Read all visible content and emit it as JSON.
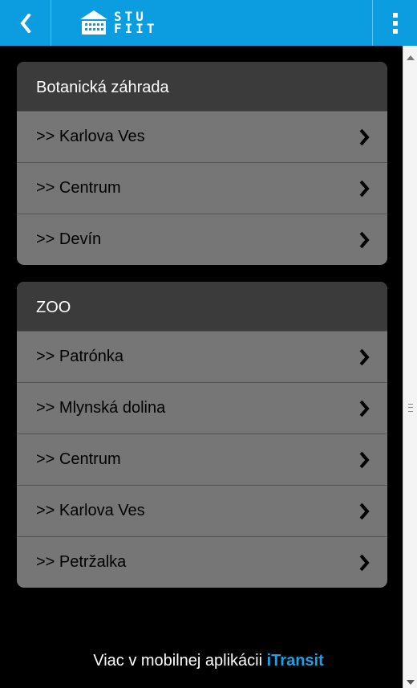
{
  "header": {
    "logo_line1": "STU",
    "logo_line2": "FIIT",
    "accent": "#0b9de0"
  },
  "groups": [
    {
      "title": "Botanická záhrada",
      "items": [
        ">> Karlova Ves",
        ">> Centrum",
        ">> Devín"
      ]
    },
    {
      "title": "ZOO",
      "items": [
        ">> Patrónka",
        ">> Mlynská dolina",
        ">> Centrum",
        ">> Karlova Ves",
        ">> Petržalka"
      ]
    }
  ],
  "footer": {
    "prefix": "Viac v mobilnej aplikácii ",
    "app_name": "iTransit"
  }
}
